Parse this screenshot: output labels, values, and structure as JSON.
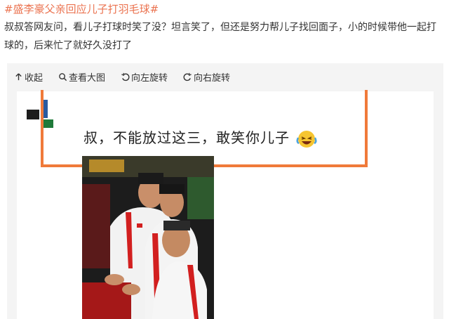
{
  "post": {
    "hashtag": "#盛李豪父亲回应儿子打羽毛球#",
    "body": "叔叔答网友问，看儿子打球时笑了没？坦言笑了，但还是努力帮儿子找回面子，小的时候带他一起打球的，后来忙了就好久没打了"
  },
  "toolbar": {
    "collapse": "收起",
    "view_large": "查看大图",
    "rotate_left": "向左旋转",
    "rotate_right": "向右旋转"
  },
  "image": {
    "caption": "叔，不能放过这三，敢笑你儿子"
  },
  "colors": {
    "hashtag": "#eb7350",
    "box_border": "#f07a3a",
    "panel_bg": "#f4f4f4"
  },
  "icons": [
    "collapse-icon",
    "search-icon",
    "rotate-left-icon",
    "rotate-right-icon",
    "laughing-emoji-icon"
  ]
}
